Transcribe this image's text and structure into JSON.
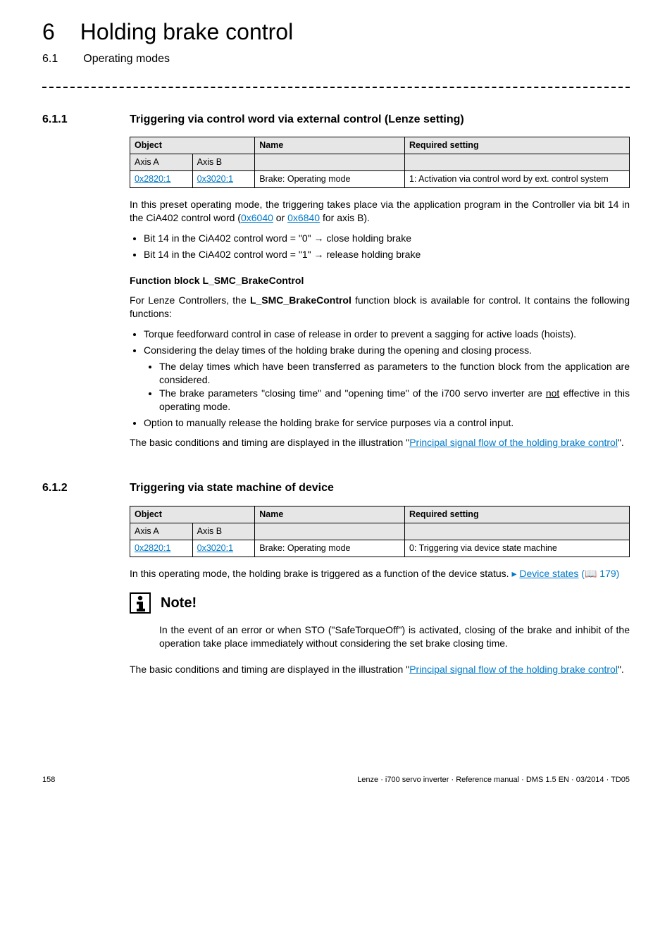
{
  "chapter": {
    "num": "6",
    "title": "Holding brake control"
  },
  "section": {
    "num": "6.1",
    "title": "Operating modes"
  },
  "s611": {
    "num": "6.1.1",
    "title": "Triggering via control word via external control (Lenze setting)",
    "table": {
      "headers": {
        "object": "Object",
        "name": "Name",
        "required": "Required setting"
      },
      "axis_a_label": "Axis A",
      "axis_b_label": "Axis B",
      "row": {
        "axis_a": "0x2820:1",
        "axis_b": "0x3020:1",
        "name": "Brake: Operating mode",
        "setting": "1: Activation via control word by ext. control system"
      }
    },
    "intro_pre": "In this preset operating mode, the triggering takes place via the application program in the Controller via bit 14 in the CiA402 control word (",
    "intro_link1": "0x6040",
    "intro_mid": " or ",
    "intro_link2": "0x6840",
    "intro_post": " for axis B).",
    "bullet1_pre": "Bit 14 in the CiA402 control word  = \"0\" ",
    "bullet1_post": " close holding brake",
    "bullet2_pre": "Bit 14 in the CiA402 control word  = \"1\" ",
    "bullet2_post": " release holding brake",
    "fb_head": "Function block L_SMC_BrakeControl",
    "fb_intro_pre": "For Lenze Controllers, the ",
    "fb_intro_bold": "L_SMC_BrakeControl",
    "fb_intro_post": " function block is available for control. It contains the following functions:",
    "fb_b1": "Torque feedforward control in case of release in order to prevent a sagging for active loads (hoists).",
    "fb_b2": "Considering the delay times of the holding brake during the opening and closing process.",
    "fb_b2a": "The delay times which have been transferred as parameters to the function block from the application are considered.",
    "fb_b2b_pre": "The brake parameters \"closing time\" and \"opening time\" of the i700 servo inverter are ",
    "fb_b2b_underline": "not",
    "fb_b2b_post": " effective in this operating mode.",
    "fb_b3": "Option to manually release the holding brake for service purposes via a control input.",
    "closing_pre": "The basic conditions and timing are displayed in the illustration \"",
    "closing_link": "Principal signal flow of the holding brake control",
    "closing_post": "\"."
  },
  "s612": {
    "num": "6.1.2",
    "title": "Triggering via state machine of device",
    "table": {
      "headers": {
        "object": "Object",
        "name": "Name",
        "required": "Required setting"
      },
      "axis_a_label": "Axis A",
      "axis_b_label": "Axis B",
      "row": {
        "axis_a": "0x2820:1",
        "axis_b": "0x3020:1",
        "name": "Brake: Operating mode",
        "setting": "0: Triggering via device state machine"
      }
    },
    "intro_pre": "In this operating mode, the holding brake is triggered as a function of the device status.  ",
    "intro_link": "Device states",
    "intro_post": " (📖 179)",
    "note_label": "Note!",
    "note_body": "In the event of an error or when STO (\"SafeTorqueOff\") is activated, closing of the brake and inhibit of the operation take place immediately without considering the set brake closing time.",
    "closing_pre": "The basic conditions and timing are displayed in the illustration \"",
    "closing_link": "Principal signal flow of the holding brake control",
    "closing_post": "\"."
  },
  "footer": {
    "page": "158",
    "meta": "Lenze · i700 servo inverter · Reference manual · DMS 1.5 EN · 03/2014 · TD05"
  },
  "glyphs": {
    "arrow_right": "→",
    "tri_right": "▸"
  }
}
